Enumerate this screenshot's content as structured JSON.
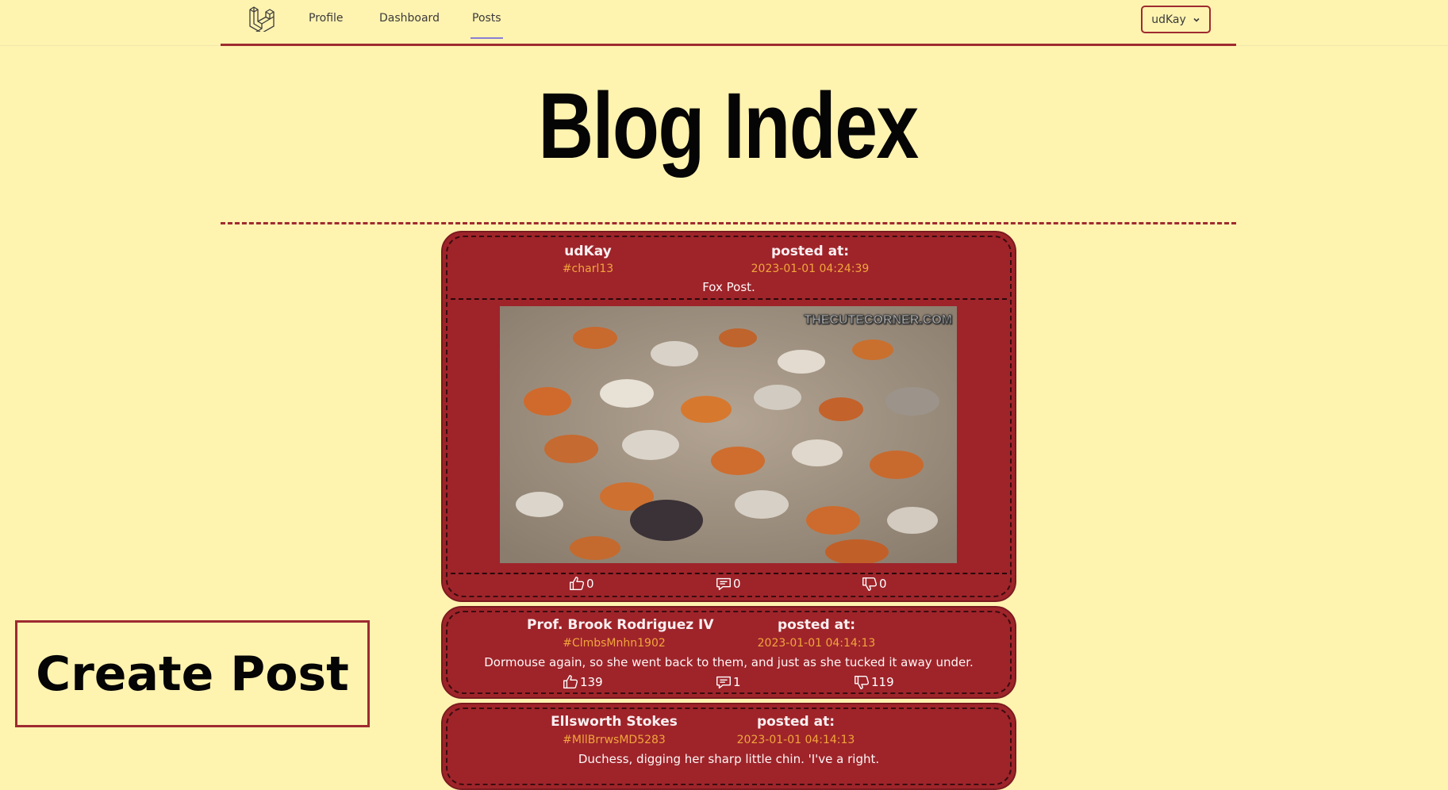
{
  "nav": {
    "links": [
      "Profile",
      "Dashboard",
      "Posts"
    ],
    "active": "Posts",
    "user": "udKay"
  },
  "page": {
    "title": "Blog Index",
    "create_button": "Create Post"
  },
  "posts": [
    {
      "author": "udKay",
      "handle": "#charl13",
      "posted_label": "posted at:",
      "date": "2023-01-01 04:24:39",
      "content": "Fox Post.",
      "image_watermark": "THECUTECORNER.COM",
      "likes": "0",
      "comments": "0",
      "dislikes": "0"
    },
    {
      "author": "Prof. Brook Rodriguez IV",
      "handle": "#ClmbsMnhn1902",
      "posted_label": "posted at:",
      "date": "2023-01-01 04:14:13",
      "content": "Dormouse again, so she went back to them, and just as she tucked it away under.",
      "likes": "139",
      "comments": "1",
      "dislikes": "119"
    },
    {
      "author": "Ellsworth Stokes",
      "handle": "#MllBrrwsMD5283",
      "posted_label": "posted at:",
      "date": "2023-01-01 04:14:13",
      "content": "Duchess, digging her sharp little chin. 'I've a right."
    }
  ],
  "colors": {
    "background": "#fff3b0",
    "card": "#9e242a",
    "accent": "#9e2b30",
    "handle": "#f3a53c"
  }
}
